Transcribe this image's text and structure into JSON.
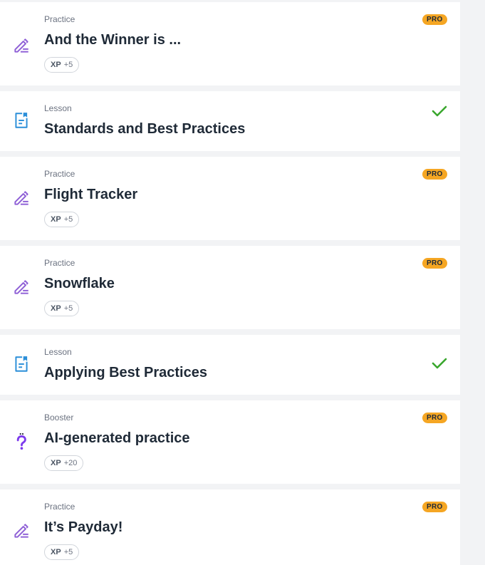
{
  "items": [
    {
      "type": "Practice",
      "title": "And the Winner is ...",
      "xp_label": "XP",
      "xp_value": "+5",
      "badge": "PRO",
      "icon": "pencil-icon"
    },
    {
      "type": "Lesson",
      "title": "Standards and Best Practices",
      "status": "completed",
      "icon": "lesson-icon"
    },
    {
      "type": "Practice",
      "title": "Flight Tracker",
      "xp_label": "XP",
      "xp_value": "+5",
      "badge": "PRO",
      "icon": "pencil-icon"
    },
    {
      "type": "Practice",
      "title": "Snowflake",
      "xp_label": "XP",
      "xp_value": "+5",
      "badge": "PRO",
      "icon": "pencil-icon"
    },
    {
      "type": "Lesson",
      "title": "Applying Best Practices",
      "status": "completed",
      "icon": "lesson-icon"
    },
    {
      "type": "Booster",
      "title": "AI-generated practice",
      "xp_label": "XP",
      "xp_value": "+20",
      "badge": "PRO",
      "icon": "question-icon"
    },
    {
      "type": "Practice",
      "title": "It’s Payday!",
      "xp_label": "XP",
      "xp_value": "+5",
      "badge": "PRO",
      "icon": "pencil-icon"
    }
  ],
  "colors": {
    "practice_icon": "#8e5fd6",
    "lesson_icon": "#2b8fd9",
    "booster_icon": "#7c3aed",
    "pro_badge": "#f5a623",
    "check": "#3aa72e",
    "background": "#f2f3f5"
  }
}
